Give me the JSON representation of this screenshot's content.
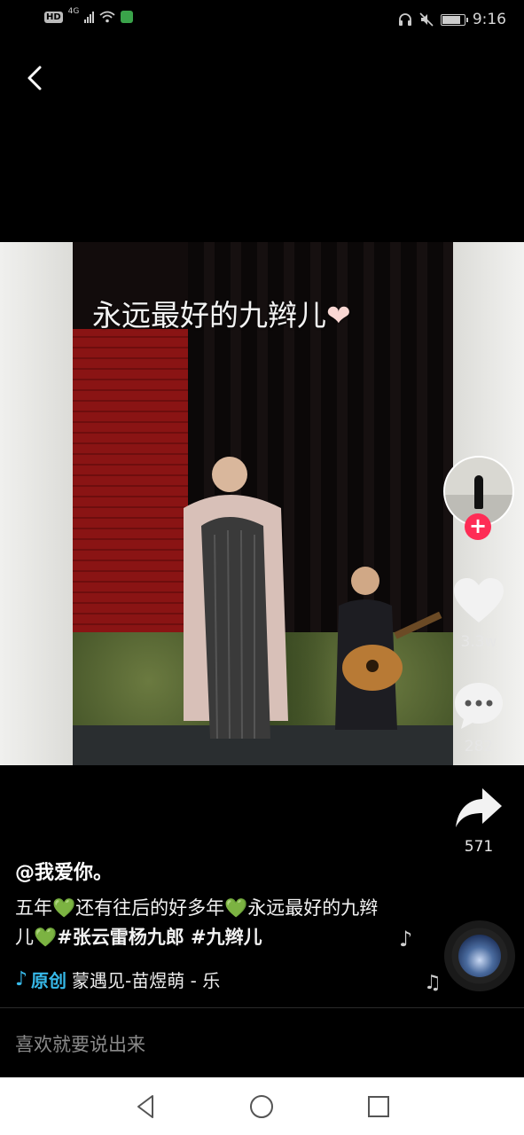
{
  "status_bar": {
    "hd": "HD",
    "network": "4G",
    "time": "9:16",
    "battery_level": 0.85
  },
  "video": {
    "caption": "永远最好的九辫儿",
    "caption_heart": "❤"
  },
  "actions": {
    "likes": "3.3w",
    "comments": "282",
    "shares": "571",
    "follow_symbol": "+"
  },
  "post": {
    "author": "@我爱你。",
    "desc_parts": {
      "p1": "五年",
      "h1": "💚",
      "p2": "还有往后的好多年",
      "h2": "💚",
      "p3": "永远最好的九辫儿",
      "h3": "💚",
      "tags": "#张云雷杨九郎 #九辫儿"
    }
  },
  "music": {
    "note_icon": "♪",
    "label": "原创",
    "track": "蒙遇见-苗煜萌 - 乐"
  },
  "comment_bar": {
    "placeholder": "喜欢就要说出来"
  },
  "icons": {
    "back": "back-icon",
    "like": "heart-icon",
    "comment": "comment-bubble-icon",
    "share": "share-arrow-icon",
    "float_note_1": "♪",
    "float_note_2": "♫"
  },
  "colors": {
    "accent_red": "#fe2c55",
    "music_blue": "#37b9e9",
    "emoji_green": "#5fc94d"
  }
}
